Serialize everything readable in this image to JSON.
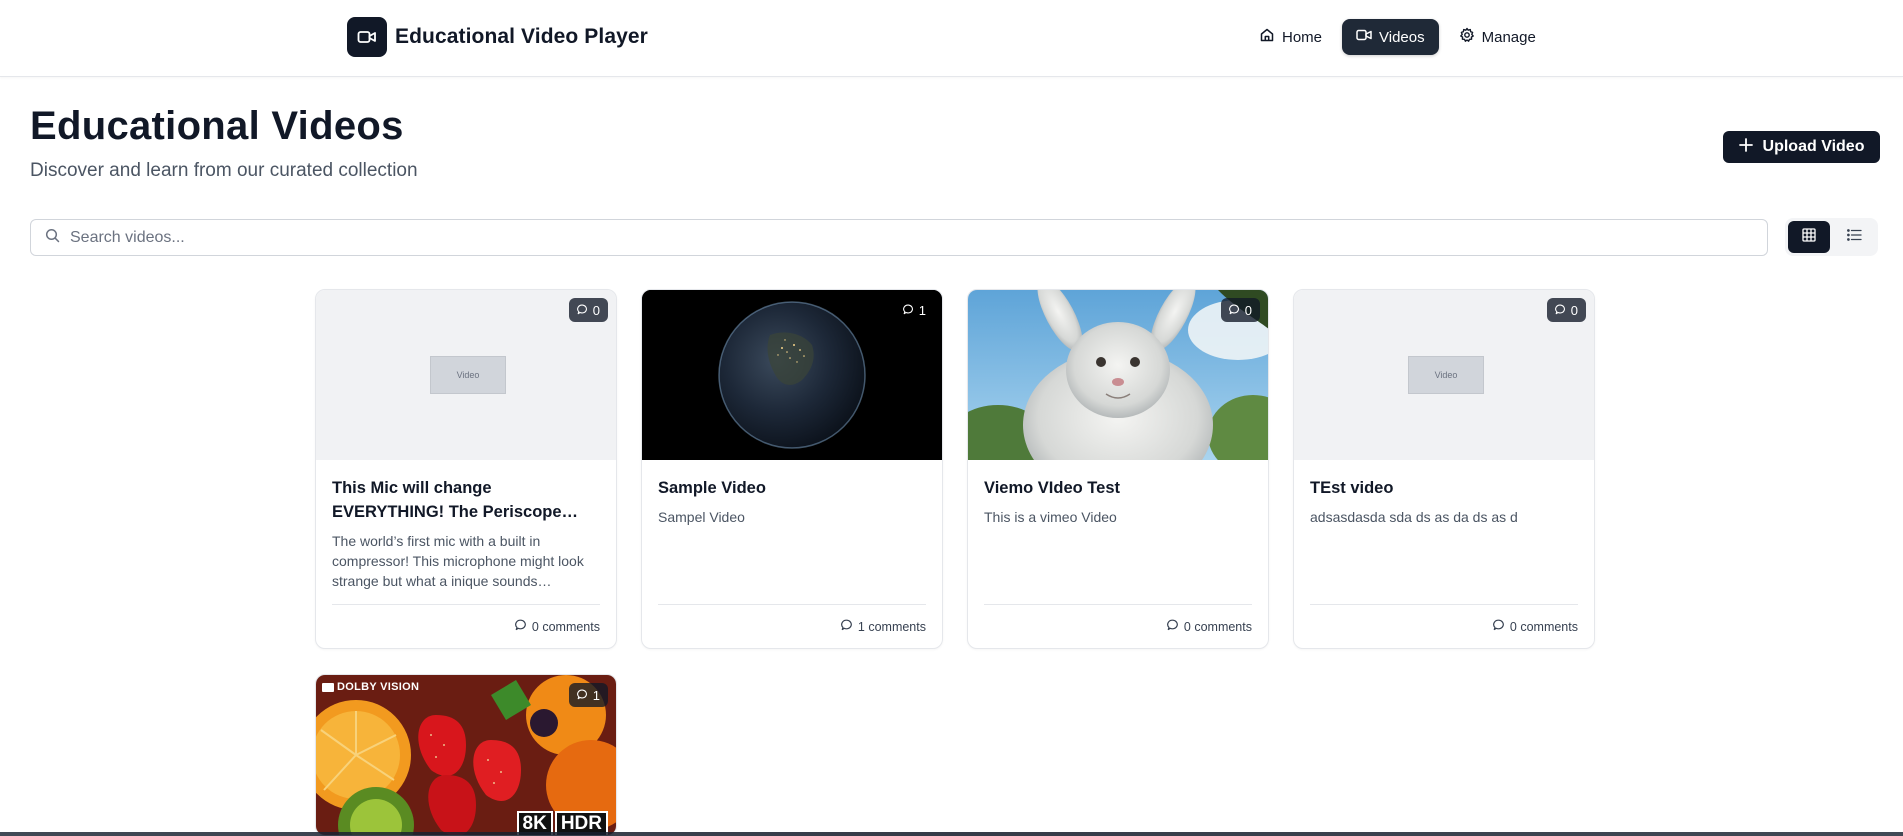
{
  "app": {
    "title": "Educational Video Player"
  },
  "nav": {
    "items": [
      {
        "label": "Home",
        "icon": "home-icon",
        "active": false
      },
      {
        "label": "Videos",
        "icon": "video-icon",
        "active": true
      },
      {
        "label": "Manage",
        "icon": "gear-icon",
        "active": false
      }
    ]
  },
  "page": {
    "title": "Educational Videos",
    "subtitle": "Discover and learn from our curated collection",
    "upload_label": "Upload Video"
  },
  "search": {
    "placeholder": "Search videos...",
    "value": ""
  },
  "view_toggle": {
    "active": "grid",
    "options": [
      "grid-view-icon",
      "list-view-icon"
    ]
  },
  "videos": [
    {
      "title": "This Mic will change EVERYTHING! The Periscope…",
      "description": "The world’s first mic with a built in compressor! This microphone might look strange but what a inique sounds…",
      "comment_count": "0",
      "comments_label": "0 comments",
      "thumbnail": "placeholder",
      "placeholder_label": "Video"
    },
    {
      "title": "Sample Video",
      "description": "Sampel Video",
      "comment_count": "1",
      "comments_label": "1 comments",
      "thumbnail": "earth"
    },
    {
      "title": "Viemo VIdeo Test",
      "description": "This is a vimeo Video",
      "comment_count": "0",
      "comments_label": "0 comments",
      "thumbnail": "bunny"
    },
    {
      "title": "TEst video",
      "description": "adsasdasda sda ds as da ds as d",
      "comment_count": "0",
      "comments_label": "0 comments",
      "thumbnail": "placeholder",
      "placeholder_label": "Video"
    },
    {
      "title": "",
      "description": "",
      "comment_count": "1",
      "comments_label": "",
      "thumbnail": "fruit",
      "overlay_top": "DOLBY VISION",
      "overlay_8k": "8K",
      "overlay_hdr": "HDR"
    }
  ],
  "colors": {
    "primary": "#111827",
    "border": "#e5e7eb",
    "muted_text": "#4b5563",
    "placeholder_bg": "#f1f2f4"
  }
}
